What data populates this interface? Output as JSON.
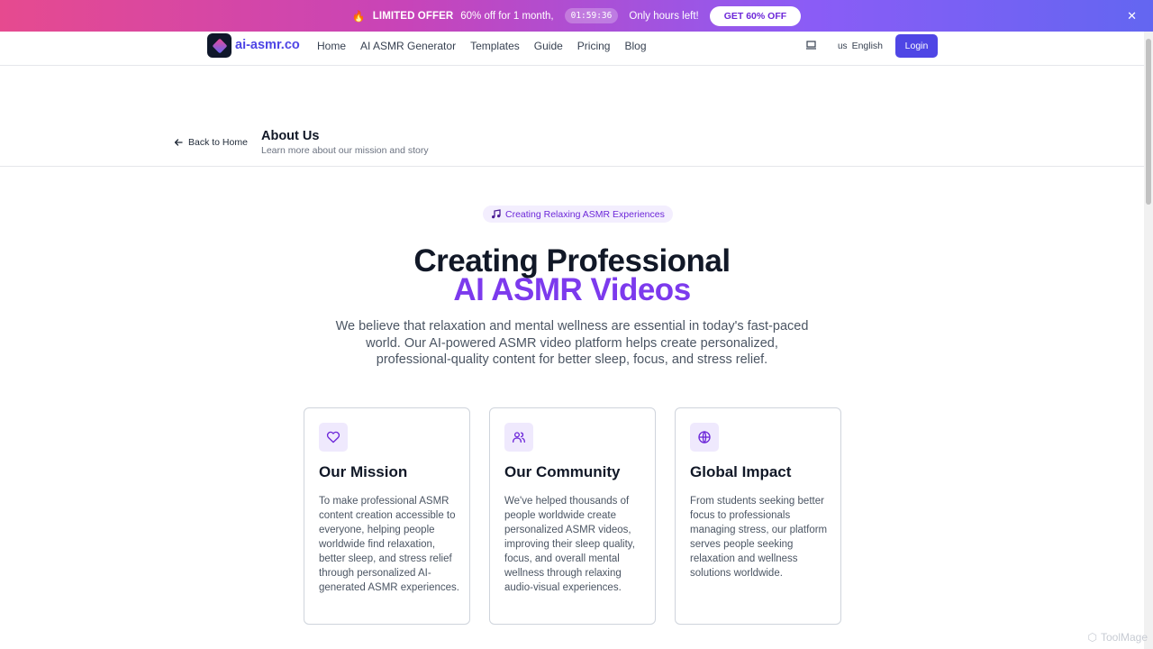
{
  "promo": {
    "label": "LIMITED OFFER",
    "text": "60% off for 1 month,",
    "timer": "01:59:36",
    "hours_left": "Only hours left!",
    "cta": "GET 60% OFF"
  },
  "nav": {
    "logo": "ai-asmr.co",
    "links": [
      "Home",
      "AI ASMR Generator",
      "Templates",
      "Guide",
      "Pricing",
      "Blog"
    ],
    "lang_code": "us",
    "lang": "English",
    "login": "Login"
  },
  "page_header": {
    "back": "Back to Home",
    "title": "About Us",
    "subtitle": "Learn more about our mission and story"
  },
  "hero": {
    "pill": "Creating Relaxing ASMR Experiences",
    "line1": "Creating Professional",
    "line2": "AI ASMR Videos",
    "description": "We believe that relaxation and mental wellness are essential in today's fast-paced world. Our AI-powered ASMR video platform helps create personalized, professional-quality content for better sleep, focus, and stress relief."
  },
  "cards": [
    {
      "icon": "heart-icon",
      "title": "Our Mission",
      "text": "To make professional ASMR content creation accessible to everyone, helping people worldwide find relaxation, better sleep, and stress relief through personalized AI-generated ASMR experiences."
    },
    {
      "icon": "users-icon",
      "title": "Our Community",
      "text": "We've helped thousands of people worldwide create personalized ASMR videos, improving their sleep quality, focus, and overall mental wellness through relaxing audio-visual experiences."
    },
    {
      "icon": "globe-icon",
      "title": "Global Impact",
      "text": "From students seeking better focus to professionals managing stress, our platform serves people seeking relaxation and wellness solutions worldwide."
    }
  ],
  "watermark": "ToolMage",
  "colors": {
    "brand": "#4f46e5",
    "accent": "#7c3aed"
  }
}
